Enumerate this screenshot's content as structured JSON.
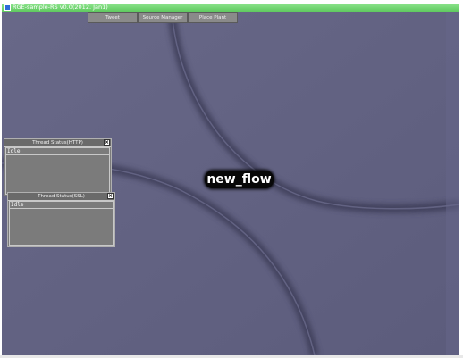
{
  "window": {
    "title": "RGE-sample-RS v0.0(2012. Jan1)",
    "title_bar_color": "#6ad66a"
  },
  "toolbar": {
    "buttons": [
      {
        "label": "Tweet"
      },
      {
        "label": "Source Manager"
      },
      {
        "label": "Place Plant"
      }
    ]
  },
  "canvas": {
    "background_color": "#606080",
    "node_label": "new_flow"
  },
  "panels": {
    "http": {
      "title": "Thread Status(HTTP)",
      "status": "Idle",
      "close_icon": "close-icon"
    },
    "ssl": {
      "title": "Thread Status(SSL)",
      "status": "Idle",
      "close_icon": "close-icon"
    }
  }
}
